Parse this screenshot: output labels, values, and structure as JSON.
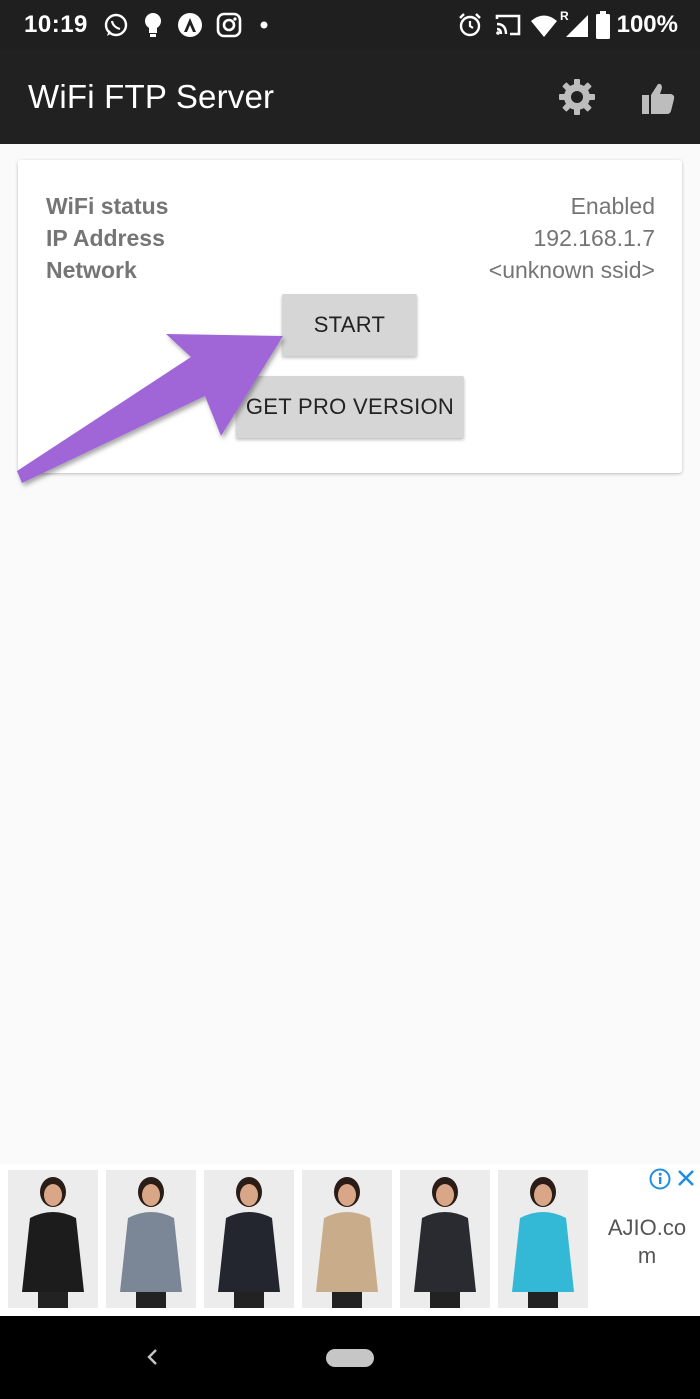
{
  "status_bar": {
    "time": "10:19",
    "battery_percent": "100%",
    "notification_icons": [
      "whatsapp-icon",
      "bulb-icon",
      "app-a-icon",
      "instagram-icon",
      "dot-icon"
    ],
    "system_icons": [
      "alarm-icon",
      "cast-icon",
      "wifi-icon",
      "signal-icon",
      "battery-icon"
    ],
    "roaming_marker": "R"
  },
  "app_bar": {
    "title": "WiFi FTP Server",
    "actions": [
      "settings-gear-icon",
      "thumbs-up-icon"
    ]
  },
  "status_card": {
    "rows": [
      {
        "label": "WiFi status",
        "value": "Enabled"
      },
      {
        "label": "IP Address",
        "value": "192.168.1.7"
      },
      {
        "label": "Network",
        "value": "<unknown ssid>"
      }
    ],
    "start_label": "START",
    "pro_label": "GET PRO VERSION"
  },
  "annotation": {
    "arrow_color": "#a066d8"
  },
  "ad": {
    "advertiser": "AJIO.co\nm",
    "tiles": 6,
    "jacket_colors": [
      "#1c1c1c",
      "#7b8796",
      "#23262e",
      "#c9ad8a",
      "#2a2b31",
      "#33b8d6"
    ]
  },
  "colors": {
    "status_bar": "#1f1f1f",
    "app_bar": "#212121",
    "background": "#fafafa",
    "button": "#d6d6d6"
  }
}
